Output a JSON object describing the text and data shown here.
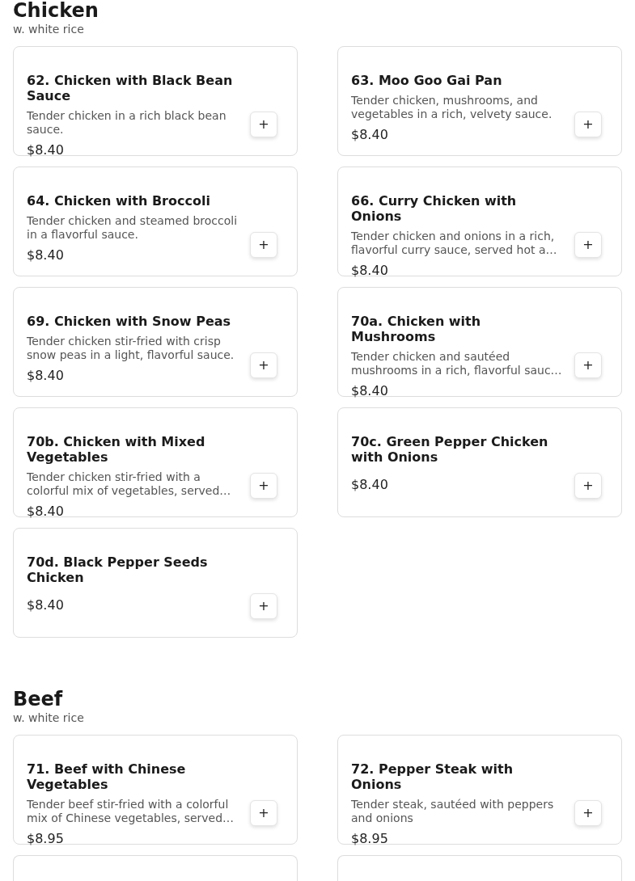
{
  "sections": [
    {
      "title": "Chicken",
      "subtitle": "w. white rice",
      "items": [
        {
          "kind": "dish",
          "name": "62. Chicken with Black Bean Sauce",
          "description": "Tender chicken in a rich black bean sauce.",
          "price": "$8.40",
          "button": "+"
        },
        {
          "kind": "dish",
          "name": "63. Moo Goo Gai Pan",
          "description": "Tender chicken, mushrooms, and vegetables in a rich, velvety sauce.",
          "price": "$8.40",
          "button": "+"
        },
        {
          "kind": "dish",
          "name": "64. Chicken with Broccoli",
          "description": "Tender chicken and steamed broccoli in a flavorful sauce.",
          "price": "$8.40",
          "button": "+"
        },
        {
          "kind": "dish",
          "name": "66. Curry Chicken with Onions",
          "description": "Tender chicken and onions in a rich, flavorful curry sauce, served hot a…",
          "price": "$8.40",
          "button": "+"
        },
        {
          "kind": "dish",
          "name": "69. Chicken with Snow Peas",
          "description": "Tender chicken stir-fried with crisp snow peas in a light, flavorful sauce.",
          "price": "$8.40",
          "button": "+"
        },
        {
          "kind": "dish",
          "name": "70a. Chicken with Mushrooms",
          "description": "Tender chicken and sautéed mushrooms in a rich, flavorful sauc…",
          "price": "$8.40",
          "button": "+"
        },
        {
          "kind": "dish",
          "name": "70b. Chicken with Mixed Vegetables",
          "description": "Tender chicken stir-fried with a colorful mix of vegetables, served…",
          "price": "$8.40",
          "button": "+"
        },
        {
          "kind": "dish",
          "name": "70c. Green Pepper Chicken with Onions",
          "price": "$8.40",
          "button": "+"
        },
        {
          "kind": "dish",
          "name": "70d. Black Pepper Seeds Chicken",
          "price": "$8.40",
          "button": "+"
        }
      ]
    },
    {
      "title": "Beef",
      "subtitle": "w. white rice",
      "items": [
        {
          "kind": "dish",
          "name": "71. Beef with Chinese Vegetables",
          "description": "Tender beef stir-fried with a colorful mix of Chinese vegetables, served…",
          "price": "$8.95",
          "button": "+"
        },
        {
          "kind": "dish",
          "name": "72. Pepper Steak with Onions",
          "description": "Tender steak, sautéed with peppers and onions",
          "price": "$8.95",
          "button": "+"
        },
        {
          "kind": "cut_off"
        },
        {
          "kind": "cut_off"
        }
      ]
    }
  ]
}
